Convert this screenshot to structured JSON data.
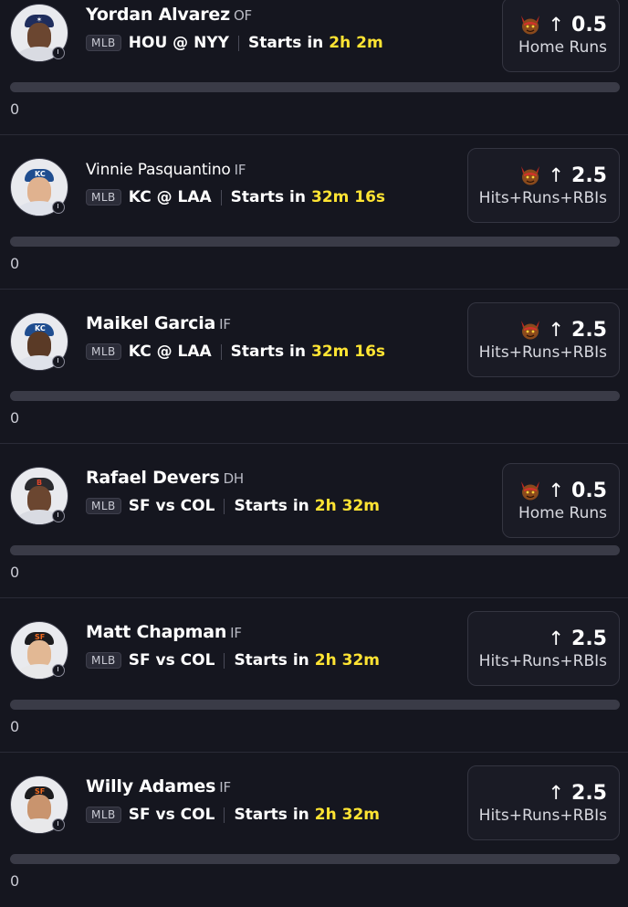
{
  "colors": {
    "background": "#15161f",
    "highlight_time": "#ffe433",
    "progress_track": "#3a3b47"
  },
  "icons": {
    "demon": "demon-icon",
    "arrow_up": "arrow-up-icon",
    "clock": "clock-icon"
  },
  "players": [
    {
      "name": "Yordan Alvarez",
      "position": "OF",
      "league": "MLB",
      "matchup": "HOU @ NYY",
      "starts_label": "Starts in",
      "starts_time": "2h 2m",
      "line_arrow": "↑",
      "line_value": "0.5",
      "stat": "Home Runs",
      "demon": true,
      "progress": 0,
      "count": "0"
    },
    {
      "name": "Vinnie Pasquantino",
      "position": "IF",
      "league": "MLB",
      "matchup": "KC @ LAA",
      "starts_label": "Starts in",
      "starts_time": "32m 16s",
      "line_arrow": "↑",
      "line_value": "2.5",
      "stat": "Hits+Runs+RBIs",
      "demon": true,
      "progress": 0,
      "count": "0"
    },
    {
      "name": "Maikel Garcia",
      "position": "IF",
      "league": "MLB",
      "matchup": "KC @ LAA",
      "starts_label": "Starts in",
      "starts_time": "32m 16s",
      "line_arrow": "↑",
      "line_value": "2.5",
      "stat": "Hits+Runs+RBIs",
      "demon": true,
      "progress": 0,
      "count": "0"
    },
    {
      "name": "Rafael Devers",
      "position": "DH",
      "league": "MLB",
      "matchup": "SF vs COL",
      "starts_label": "Starts in",
      "starts_time": "2h 32m",
      "line_arrow": "↑",
      "line_value": "0.5",
      "stat": "Home Runs",
      "demon": true,
      "progress": 0,
      "count": "0"
    },
    {
      "name": "Matt Chapman",
      "position": "IF",
      "league": "MLB",
      "matchup": "SF vs COL",
      "starts_label": "Starts in",
      "starts_time": "2h 32m",
      "line_arrow": "↑",
      "line_value": "2.5",
      "stat": "Hits+Runs+RBIs",
      "demon": false,
      "progress": 0,
      "count": "0"
    },
    {
      "name": "Willy Adames",
      "position": "IF",
      "league": "MLB",
      "matchup": "SF vs COL",
      "starts_label": "Starts in",
      "starts_time": "2h 32m",
      "line_arrow": "↑",
      "line_value": "2.5",
      "stat": "Hits+Runs+RBIs",
      "demon": false,
      "progress": 0,
      "count": "0"
    }
  ]
}
